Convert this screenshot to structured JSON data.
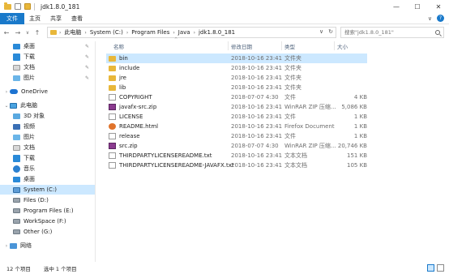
{
  "window": {
    "title": "jdk1.8.0_181",
    "min": "—",
    "max": "☐",
    "close": "✕"
  },
  "ribbon": {
    "tabs": [
      "文件",
      "主页",
      "共享",
      "查看"
    ],
    "expand": "∨",
    "help": "?"
  },
  "nav": {
    "back": "←",
    "forward": "→",
    "recent": "∨",
    "up": "↑",
    "crumbs": [
      "此电脑",
      "System (C:)",
      "Program Files",
      "Java",
      "jdk1.8.0_181"
    ],
    "search_placeholder": "搜索\"jdk1.8.0_181\"",
    "dropdown": "∨",
    "refresh": "↻"
  },
  "sidebar": {
    "items": [
      {
        "label": "桌面",
        "icon": "folder",
        "pinned": true
      },
      {
        "label": "下载",
        "icon": "download",
        "pinned": true
      },
      {
        "label": "文档",
        "icon": "folder",
        "pinned": true
      },
      {
        "label": "图片",
        "icon": "folder",
        "pinned": true
      },
      {
        "label": "OneDrive",
        "icon": "cloud"
      },
      {
        "label": "此电脑",
        "icon": "pc"
      },
      {
        "label": "3D 对象",
        "icon": "folder"
      },
      {
        "label": "视频",
        "icon": "folder"
      },
      {
        "label": "图片",
        "icon": "folder"
      },
      {
        "label": "文档",
        "icon": "folder"
      },
      {
        "label": "下载",
        "icon": "download"
      },
      {
        "label": "音乐",
        "icon": "music"
      },
      {
        "label": "桌面",
        "icon": "folder"
      },
      {
        "label": "System (C:)",
        "icon": "cdrive",
        "selected": true
      },
      {
        "label": "Files (D:)",
        "icon": "drive"
      },
      {
        "label": "Program Files (E:)",
        "icon": "drive"
      },
      {
        "label": "WorkSpace (F:)",
        "icon": "drive"
      },
      {
        "label": "Other (G:)",
        "icon": "drive"
      },
      {
        "label": "网络",
        "icon": "network"
      }
    ],
    "pin_glyph": "✎",
    "expand_glyph": "›"
  },
  "columns": {
    "name": "名称",
    "date": "修改日期",
    "type": "类型",
    "size": "大小",
    "sort": "^"
  },
  "files": [
    {
      "name": "bin",
      "date": "2018-10-16 23:41",
      "type": "文件夹",
      "size": "",
      "icon": "folder",
      "selected": true
    },
    {
      "name": "include",
      "date": "2018-10-16 23:41",
      "type": "文件夹",
      "size": "",
      "icon": "folder"
    },
    {
      "name": "jre",
      "date": "2018-10-16 23:41",
      "type": "文件夹",
      "size": "",
      "icon": "folder"
    },
    {
      "name": "lib",
      "date": "2018-10-16 23:41",
      "type": "文件夹",
      "size": "",
      "icon": "folder"
    },
    {
      "name": "COPYRIGHT",
      "date": "2018-07-07 4:30",
      "type": "文件",
      "size": "4 KB",
      "icon": "doc"
    },
    {
      "name": "javafx-src.zip",
      "date": "2018-10-16 23:41",
      "type": "WinRAR ZIP 压缩...",
      "size": "5,086 KB",
      "icon": "zip"
    },
    {
      "name": "LICENSE",
      "date": "2018-10-16 23:41",
      "type": "文件",
      "size": "1 KB",
      "icon": "doc"
    },
    {
      "name": "README.html",
      "date": "2018-10-16 23:41",
      "type": "Firefox Document",
      "size": "1 KB",
      "icon": "html"
    },
    {
      "name": "release",
      "date": "2018-10-16 23:41",
      "type": "文件",
      "size": "1 KB",
      "icon": "doc"
    },
    {
      "name": "src.zip",
      "date": "2018-07-07 4:30",
      "type": "WinRAR ZIP 压缩...",
      "size": "20,746 KB",
      "icon": "zip"
    },
    {
      "name": "THIRDPARTYLICENSEREADME.txt",
      "date": "2018-10-16 23:41",
      "type": "文本文档",
      "size": "151 KB",
      "icon": "doc"
    },
    {
      "name": "THIRDPARTYLICENSEREADME-JAVAFX.txt",
      "date": "2018-10-16 23:41",
      "type": "文本文档",
      "size": "105 KB",
      "icon": "doc"
    }
  ],
  "status": {
    "count": "12 个项目",
    "selection": "选中 1 个项目"
  }
}
